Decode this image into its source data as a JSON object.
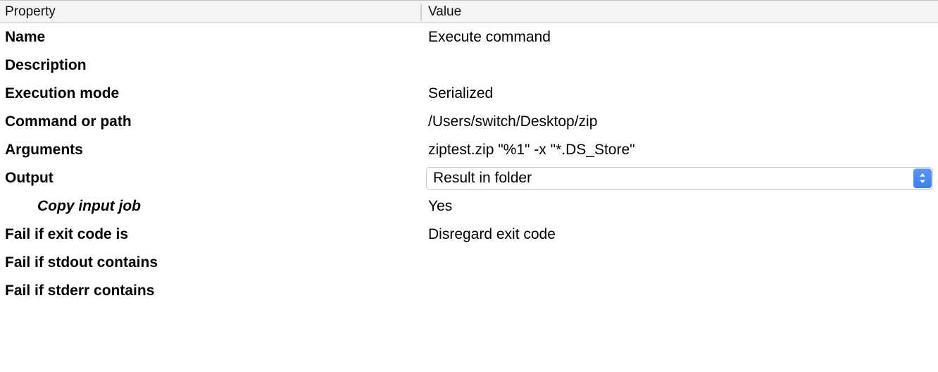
{
  "table": {
    "columns": [
      {
        "key": "property",
        "label": "Property"
      },
      {
        "key": "value",
        "label": "Value"
      }
    ],
    "rows": [
      {
        "property": "Name",
        "value": "Execute command",
        "indent": false,
        "type": "text"
      },
      {
        "property": "Description",
        "value": "",
        "indent": false,
        "type": "text"
      },
      {
        "property": "Execution mode",
        "value": "Serialized",
        "indent": false,
        "type": "text"
      },
      {
        "property": "Command or path",
        "value": "/Users/switch/Desktop/zip",
        "indent": false,
        "type": "text"
      },
      {
        "property": "Arguments",
        "value": "ziptest.zip \"%1\" -x \"*.DS_Store\"",
        "indent": false,
        "type": "text"
      },
      {
        "property": "Output",
        "value": "Result in folder",
        "indent": false,
        "type": "popup"
      },
      {
        "property": "Copy input job",
        "value": "Yes",
        "indent": true,
        "type": "text"
      },
      {
        "property": "Fail if exit code is",
        "value": "Disregard exit code",
        "indent": false,
        "type": "text"
      },
      {
        "property": "Fail if stdout contains",
        "value": "",
        "indent": false,
        "type": "text"
      },
      {
        "property": "Fail if stderr contains",
        "value": "",
        "indent": false,
        "type": "text"
      }
    ]
  },
  "popup": {
    "selected": "Result in folder",
    "stepper_icon": "chevron-up-down-icon",
    "accent_color": "#3a80f0"
  },
  "colors": {
    "header_background": "#f4f4f4",
    "header_border": "#c2c2c2",
    "body_background": "#ffffff",
    "text": "#000000",
    "popup_border": "#c8c8c8",
    "accent": "#3a80f0"
  }
}
